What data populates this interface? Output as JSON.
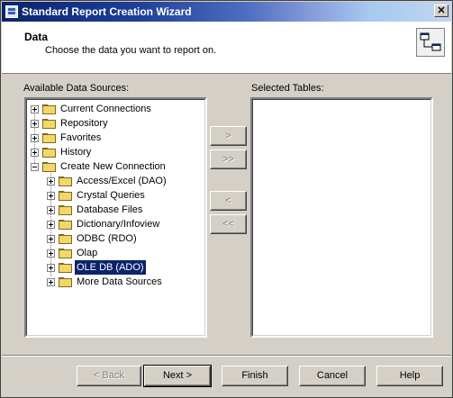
{
  "window": {
    "title": "Standard Report Creation Wizard",
    "close_label": "✕"
  },
  "header": {
    "title": "Data",
    "subtitle": "Choose the data you want to report on."
  },
  "available": {
    "label": "Available Data Sources:",
    "items": [
      {
        "label": "Current Connections"
      },
      {
        "label": "Repository"
      },
      {
        "label": "Favorites"
      },
      {
        "label": "History"
      },
      {
        "label": "Create New Connection"
      },
      {
        "label": "Access/Excel (DAO)"
      },
      {
        "label": "Crystal Queries"
      },
      {
        "label": "Database Files"
      },
      {
        "label": "Dictionary/Infoview"
      },
      {
        "label": "ODBC (RDO)"
      },
      {
        "label": "Olap"
      },
      {
        "label": "OLE DB (ADO)"
      },
      {
        "label": "More Data Sources"
      }
    ],
    "selected_item": "OLE DB (ADO)"
  },
  "selected_tables": {
    "label": "Selected Tables:"
  },
  "transfer_buttons": {
    "add": ">",
    "add_all": ">>",
    "remove": "<",
    "remove_all": "<<"
  },
  "footer": {
    "back": "< Back",
    "next": "Next >",
    "finish": "Finish",
    "cancel": "Cancel",
    "help": "Help"
  },
  "colors": {
    "selection": "#0a246a",
    "folder": "#f3d768",
    "face": "#d4d0c8"
  }
}
